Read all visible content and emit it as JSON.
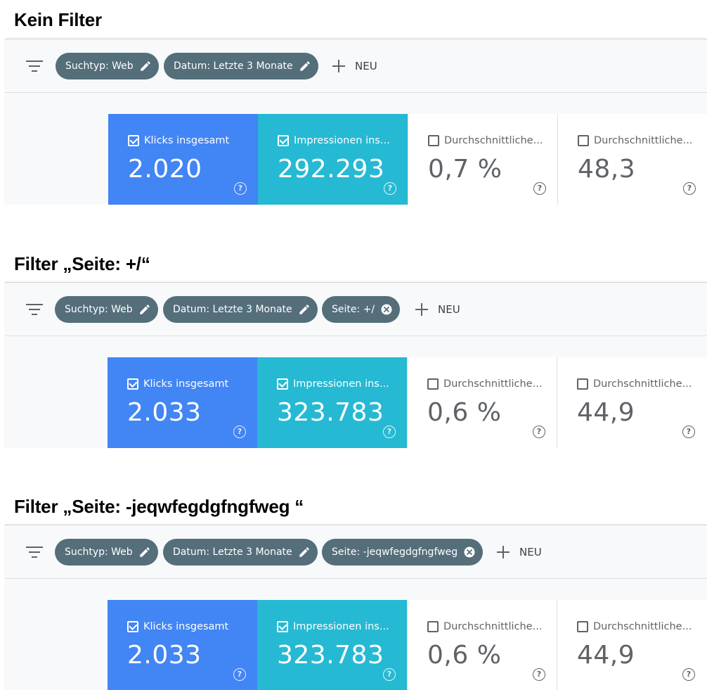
{
  "sections": [
    {
      "title": "Kein Filter",
      "chips": [
        {
          "label": "Suchtyp: Web",
          "icon": "pencil-icon"
        },
        {
          "label": "Datum: Letzte 3 Monate",
          "icon": "pencil-icon"
        }
      ],
      "new_label": "NEU",
      "cards": [
        {
          "label": "Klicks insgesamt",
          "value": "2.020",
          "checked": true
        },
        {
          "label": "Impressionen ins...",
          "value": "292.293",
          "checked": true
        },
        {
          "label": "Durchschnittliche...",
          "value": "0,7 %",
          "checked": false
        },
        {
          "label": "Durchschnittliche...",
          "value": "48,3",
          "checked": false
        }
      ]
    },
    {
      "title": "Filter „Seite: +/“",
      "chips": [
        {
          "label": "Suchtyp: Web",
          "icon": "pencil-icon"
        },
        {
          "label": "Datum: Letzte 3 Monate",
          "icon": "pencil-icon"
        },
        {
          "label": "Seite: +/",
          "icon": "close-circle-icon"
        }
      ],
      "new_label": "NEU",
      "cards": [
        {
          "label": "Klicks insgesamt",
          "value": "2.033",
          "checked": true
        },
        {
          "label": "Impressionen ins...",
          "value": "323.783",
          "checked": true
        },
        {
          "label": "Durchschnittliche...",
          "value": "0,6 %",
          "checked": false
        },
        {
          "label": "Durchschnittliche...",
          "value": "44,9",
          "checked": false
        }
      ]
    },
    {
      "title": "Filter „Seite: -jeqwfegdgfngfweg “",
      "chips": [
        {
          "label": "Suchtyp: Web",
          "icon": "pencil-icon"
        },
        {
          "label": "Datum: Letzte 3 Monate",
          "icon": "pencil-icon"
        },
        {
          "label": "Seite: -jeqwfegdgfngfweg",
          "icon": "close-circle-icon"
        }
      ],
      "new_label": "NEU",
      "cards": [
        {
          "label": "Klicks insgesamt",
          "value": "2.033",
          "checked": true
        },
        {
          "label": "Impressionen ins...",
          "value": "323.783",
          "checked": true
        },
        {
          "label": "Durchschnittliche...",
          "value": "0,6 %",
          "checked": false
        },
        {
          "label": "Durchschnittliche...",
          "value": "44,9",
          "checked": false
        }
      ]
    }
  ],
  "colors": {
    "chip": "#546e7a",
    "clicks_card": "#4285f4",
    "impressions_card": "#26b9d3"
  }
}
